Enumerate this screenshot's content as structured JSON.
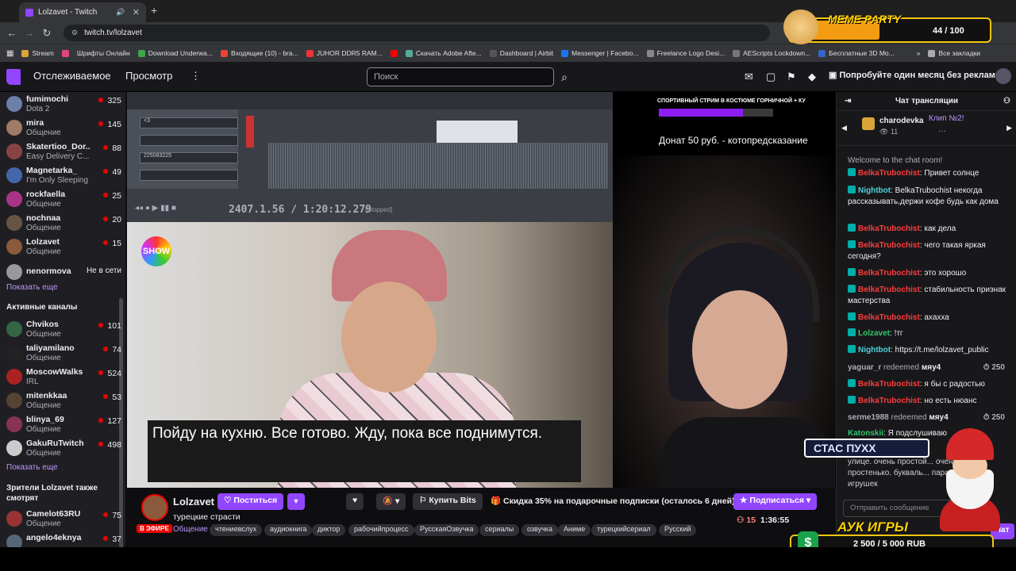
{
  "browser": {
    "tab_title": "Lolzavet - Twitch",
    "url": "twitch.tv/lolzavet",
    "bookmarks": [
      "Stream",
      "Шрифты Онлайн",
      "Download Underwa...",
      "Входящие (10) - bra...",
      "JUHOR DDR5 RAM...",
      "Скачать Adobe Afte...",
      "Dashboard | Airbit",
      "Messenger | Facebo...",
      "Freelance Logo Desi...",
      "AEScripts Lockdown...",
      "Бесплатные 3D Mo...",
      "Все закладки"
    ]
  },
  "twitch_nav": {
    "following": "Отслеживаемое",
    "browse": "Просмотр",
    "more": "⋮",
    "search_placeholder": "Поиск",
    "promo": "Попробуйте один месяц без рекламы"
  },
  "sidebar": {
    "followed": [
      {
        "name": "fumimochi",
        "cat": "Dota 2",
        "viewers": "325",
        "color": "#6b7fa8"
      },
      {
        "name": "mira",
        "cat": "Общение",
        "viewers": "145",
        "color": "#a07b66"
      },
      {
        "name": "Skatertioo_Dor...",
        "cat": "Easy Delivery C...",
        "viewers": "88",
        "color": "#884444"
      },
      {
        "name": "Magnetarka_",
        "cat": "I'm Only Sleeping",
        "viewers": "49",
        "color": "#4466aa"
      },
      {
        "name": "rockfaella",
        "cat": "Общение",
        "viewers": "25",
        "color": "#aa3388"
      },
      {
        "name": "nochnaa",
        "cat": "Общение",
        "viewers": "20",
        "color": "#665544"
      },
      {
        "name": "Lolzavet",
        "cat": "Общение",
        "viewers": "15",
        "color": "#8b5a3c"
      }
    ],
    "offline": {
      "name": "nenormova",
      "status": "Не в сети"
    },
    "show_more": "Показать еще",
    "active_title": "Активные каналы",
    "active": [
      {
        "name": "Chvikos",
        "cat": "Общение",
        "viewers": "101",
        "color": "#336644"
      },
      {
        "name": "taliyamilano",
        "cat": "Общение",
        "viewers": "74",
        "color": "#222222"
      },
      {
        "name": "MoscowWalks",
        "cat": "IRL",
        "viewers": "524",
        "color": "#aa2222"
      },
      {
        "name": "mitenkkaa",
        "cat": "Общение",
        "viewers": "53",
        "color": "#554433"
      },
      {
        "name": "blinya_69",
        "cat": "Общение",
        "viewers": "127",
        "color": "#883355"
      },
      {
        "name": "GakuRuTwitch",
        "cat": "Общение",
        "viewers": "498",
        "color": "#cccccc"
      }
    ],
    "show_more2": "Показать еще",
    "also_title": "Зрители Lolzavet также смотрят",
    "also": [
      {
        "name": "Camelot63RU",
        "cat": "Общение",
        "viewers": "75",
        "color": "#993333"
      },
      {
        "name": "angelo4eknya",
        "cat": "",
        "viewers": "37",
        "color": "#556677"
      }
    ]
  },
  "video": {
    "timecode": "2407.1.56 / 1:20:12.279",
    "status": "[Stopped]",
    "show_logo": "SHOW",
    "subtitle": "Пойду на кухню. Все готово. Жду, пока все поднимутся.",
    "banner": "СПОРТИВНЫЙ СТРИМ В КОСТЮМЕ ГОРНИЧНОЙ + КУ",
    "donat": "Донат 50 руб. - котопредсказание"
  },
  "stream": {
    "streamer": "Lolzavet",
    "live": "В ЭФИРЕ",
    "follow": "Поститься",
    "title": "турецкие страсти",
    "category": "Общение",
    "tags": [
      "чтениевслух",
      "аудиокнига",
      "диктор",
      "рабочийпроцесс",
      "РусскаяОзвучка",
      "сериалы",
      "озвучка",
      "Аниме",
      "турецкийсериал",
      "Русский"
    ],
    "bits": "Купить Bits",
    "discount": "Скидка 35% на подарочные подписки (осталось 6 дней)",
    "subscribe": "Подписаться",
    "viewers": "15",
    "uptime": "1:36:55"
  },
  "chat": {
    "header": "Чат трансляции",
    "pinned_user": "charodevka",
    "pinned_count": "11",
    "pinned_clip": "Клип №2!",
    "welcome": "Welcome to the chat room!",
    "messages": [
      {
        "user": "BelkaTrubochist",
        "color": "red",
        "text": "Привет солнце"
      },
      {
        "user": "Nightbot",
        "color": "teal",
        "text": "BelkaTrubochist некогда рассказывать,держи кофе  будь как дома"
      },
      {
        "user": "BelkaTrubochist",
        "color": "red",
        "text": "как дела"
      },
      {
        "user": "BelkaTrubochist",
        "color": "red",
        "text": "чего такая яркая сегодня?"
      },
      {
        "user": "BelkaTrubochist",
        "color": "red",
        "text": "это хорошо"
      },
      {
        "user": "BelkaTrubochist",
        "color": "red",
        "text": "стабильность признак мастерства"
      },
      {
        "user": "BelkaTrubochist",
        "color": "red",
        "text": "ахахха"
      },
      {
        "user": "Lolzavet",
        "color": "green",
        "text": "!тг"
      },
      {
        "user": "Nightbot",
        "color": "teal",
        "text": "https://t.me/lolzavet_public"
      }
    ],
    "redeem1": {
      "user": "yaguar_r",
      "action": "redeemed",
      "item": "мяу4",
      "points": "250"
    },
    "msg_after1": [
      {
        "user": "BelkaTrubochist",
        "color": "red",
        "text": "я бы с радостью"
      },
      {
        "user": "BelkaTrubochist",
        "color": "red",
        "text": "но есть нюанс"
      }
    ],
    "redeem2": {
      "user": "serme1988",
      "action": "redeemed",
      "item": "мяу4",
      "points": "250"
    },
    "last": {
      "user": "Katonskii",
      "text": "Я подслушиваю",
      "cont": "улице. очень простой... очень простенько. букваль... пара игрушек"
    },
    "input_placeholder": "Отправить сообщение",
    "chat_btn": "Чат"
  },
  "overlays": {
    "meme_title": "MEME PARTY",
    "meme_count": "44 / 100",
    "meme_progress": 0.44,
    "stas": "СТАС ПУХХ",
    "auk_title": "АУК ИГРЫ",
    "auk_amount": "2 500 / 5 000 RUB",
    "auk_progress": 0.5
  }
}
